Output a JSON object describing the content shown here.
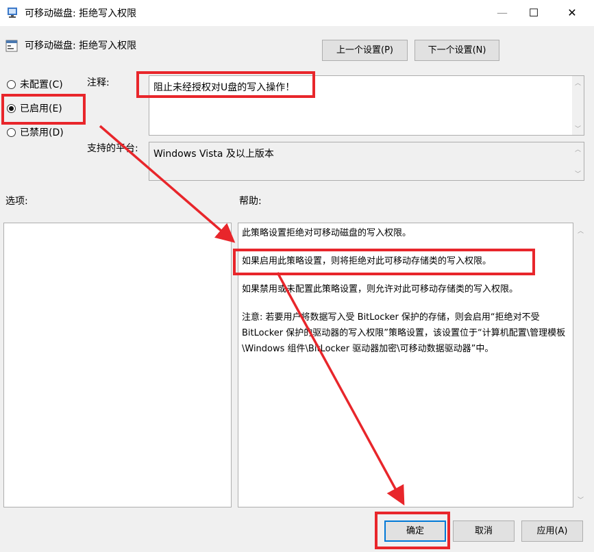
{
  "window": {
    "title": "可移动磁盘: 拒绝写入权限",
    "minimize_glyph": "—",
    "maximize_glyph": "☐",
    "close_glyph": "✕"
  },
  "header": {
    "policy_title": "可移动磁盘: 拒绝写入权限",
    "prev_button": "上一个设置(P)",
    "next_button": "下一个设置(N)"
  },
  "state": {
    "options": [
      {
        "label": "未配置(C)",
        "checked": false
      },
      {
        "label": "已启用(E)",
        "checked": true
      },
      {
        "label": "已禁用(D)",
        "checked": false
      }
    ]
  },
  "comment": {
    "label": "注释:",
    "value": "阻止未经授权对U盘的写入操作！"
  },
  "platform": {
    "label": "支持的平台:",
    "value": "Windows Vista 及以上版本"
  },
  "options_panel": {
    "label": "选项:"
  },
  "help_panel": {
    "label": "帮助:",
    "paragraphs": [
      "此策略设置拒绝对可移动磁盘的写入权限。",
      "如果启用此策略设置，则将拒绝对此可移动存储类的写入权限。",
      "如果禁用或未配置此策略设置，则允许对此可移动存储类的写入权限。",
      "注意: 若要用户将数据写入受 BitLocker 保护的存储，则会启用“拒绝对不受 BitLocker 保护的驱动器的写入权限”策略设置，该设置位于“计算机配置\\管理模板\\Windows 组件\\BitLocker 驱动器加密\\可移动数据驱动器”中。"
    ]
  },
  "footer": {
    "ok": "确定",
    "cancel": "取消",
    "apply": "应用(A)"
  },
  "colors": {
    "highlight": "#e8262b",
    "accent": "#0078d7"
  }
}
